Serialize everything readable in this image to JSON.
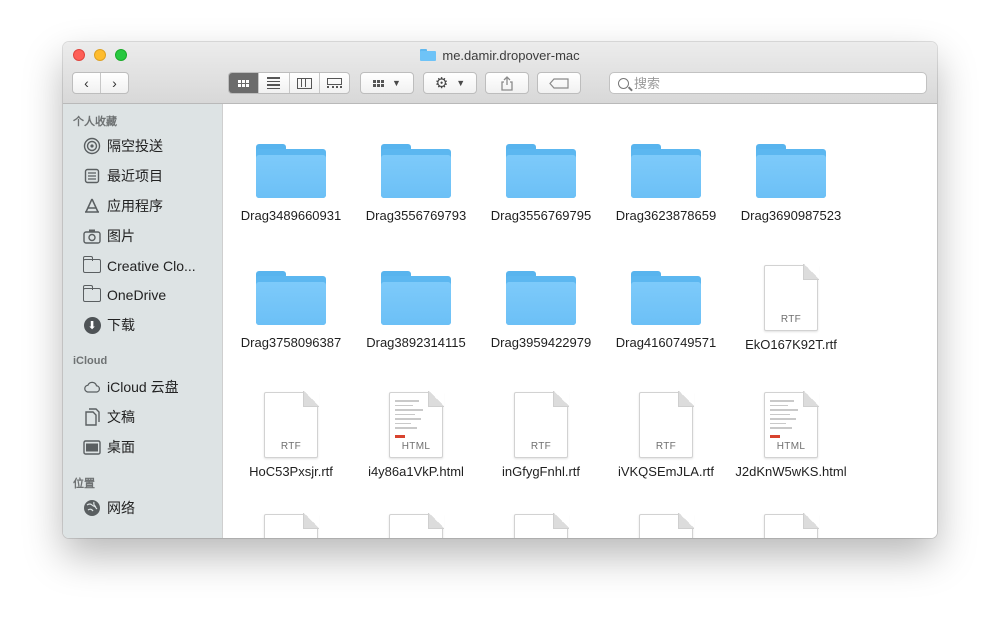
{
  "window": {
    "title": "me.damir.dropover-mac"
  },
  "toolbar": {
    "back": "‹",
    "forward": "›",
    "search_placeholder": "搜索"
  },
  "sidebar": {
    "sections": [
      {
        "label": "个人收藏",
        "items": [
          {
            "label": "隔空投送",
            "icon": "airdrop-icon"
          },
          {
            "label": "最近项目",
            "icon": "recents-icon"
          },
          {
            "label": "应用程序",
            "icon": "applications-icon"
          },
          {
            "label": "图片",
            "icon": "camera-icon"
          },
          {
            "label": "Creative Clo...",
            "icon": "folder-icon"
          },
          {
            "label": "OneDrive",
            "icon": "folder-icon"
          },
          {
            "label": "下载",
            "icon": "download-icon"
          }
        ]
      },
      {
        "label": "iCloud",
        "items": [
          {
            "label": "iCloud 云盘",
            "icon": "cloud-icon"
          },
          {
            "label": "文稿",
            "icon": "documents-icon"
          },
          {
            "label": "桌面",
            "icon": "desktop-icon"
          }
        ]
      },
      {
        "label": "位置",
        "items": [
          {
            "label": "网络",
            "icon": "network-icon"
          }
        ]
      }
    ]
  },
  "files": [
    {
      "name": "Drag3489660931",
      "kind": "folder"
    },
    {
      "name": "Drag3556769793",
      "kind": "folder"
    },
    {
      "name": "Drag3556769795",
      "kind": "folder"
    },
    {
      "name": "Drag3623878659",
      "kind": "folder"
    },
    {
      "name": "Drag3690987523",
      "kind": "folder"
    },
    {
      "name": "Drag3758096387",
      "kind": "folder"
    },
    {
      "name": "Drag3892314115",
      "kind": "folder"
    },
    {
      "name": "Drag3959422979",
      "kind": "folder"
    },
    {
      "name": "Drag4160749571",
      "kind": "folder"
    },
    {
      "name": "EkO167K92T.rtf",
      "kind": "doc",
      "ext": "RTF"
    },
    {
      "name": "HoC53Pxsjr.rtf",
      "kind": "doc",
      "ext": "RTF"
    },
    {
      "name": "i4y86a1VkP.html",
      "kind": "doc",
      "ext": "HTML"
    },
    {
      "name": "inGfygFnhl.rtf",
      "kind": "doc",
      "ext": "RTF"
    },
    {
      "name": "iVKQSEmJLA.rtf",
      "kind": "doc",
      "ext": "RTF"
    },
    {
      "name": "J2dKnW5wKS.html",
      "kind": "doc",
      "ext": "HTML"
    }
  ],
  "colors": {
    "accent_folder": "#6ec3f7",
    "sidebar_bg": "#dde3e4",
    "html_badge": "#d8432f"
  }
}
